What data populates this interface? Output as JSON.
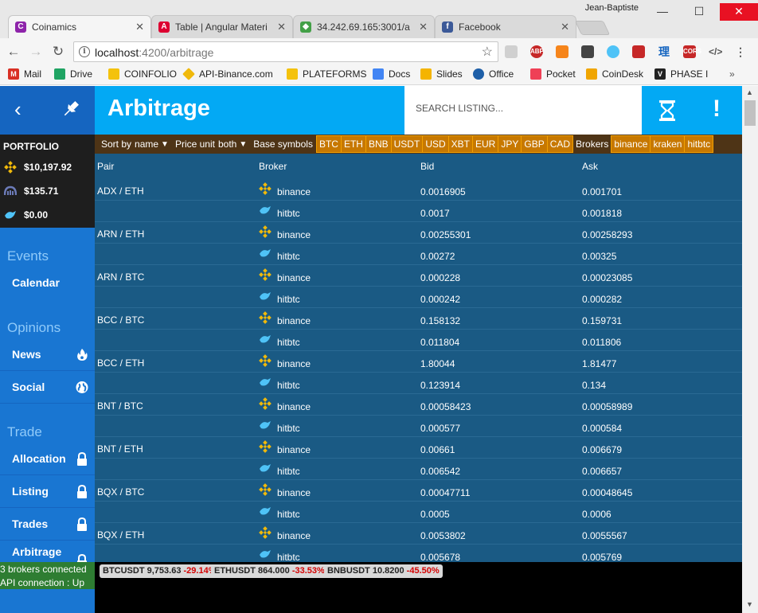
{
  "window": {
    "user": "Jean-Baptiste"
  },
  "tabs": [
    {
      "title": "Coinamics",
      "icon": "coinamics-favicon",
      "active": true
    },
    {
      "title": "Table | Angular Materi",
      "icon": "angular-favicon"
    },
    {
      "title": "34.242.69.165:3001/a",
      "icon": "node-favicon"
    },
    {
      "title": "Facebook",
      "icon": "facebook-favicon"
    }
  ],
  "address": {
    "host": "localhost",
    "path": ":4200/arbitrage"
  },
  "bookmarks": [
    {
      "label": "Mail",
      "icon": "gmail-icon",
      "color": "#d93025"
    },
    {
      "label": "Drive",
      "icon": "drive-icon",
      "color": "#1fa463"
    },
    {
      "label": "COINFOLIO",
      "icon": "folder-icon",
      "color": "#f4c20d"
    },
    {
      "label": "API-Binance.com",
      "icon": "binance-icon",
      "color": "#f0b90b"
    },
    {
      "label": "PLATEFORMS",
      "icon": "folder-icon",
      "color": "#f4c20d"
    },
    {
      "label": "Docs",
      "icon": "docs-icon",
      "color": "#4285f4"
    },
    {
      "label": "Slides",
      "icon": "slides-icon",
      "color": "#f4b400"
    },
    {
      "label": "Office",
      "icon": "office-icon",
      "color": "#1e5fa8"
    },
    {
      "label": "Pocket",
      "icon": "pocket-icon",
      "color": "#ef4056"
    },
    {
      "label": "CoinDesk",
      "icon": "coindesk-icon",
      "color": "#f0a500"
    },
    {
      "label": "PHASE I",
      "icon": "phase-icon",
      "color": "#222222"
    }
  ],
  "header": {
    "title": "Arbitrage",
    "search_placeholder": "SEARCH LISTING..."
  },
  "portfolio": {
    "title": "PORTFOLIO",
    "rows": [
      {
        "value": "$10,197.92",
        "icon": "binance-icon"
      },
      {
        "value": "$135.71",
        "icon": "kraken-icon"
      },
      {
        "value": "$0.00",
        "icon": "hitbtc-icon"
      }
    ]
  },
  "sidebar": {
    "events": {
      "title": "Events",
      "items": [
        "Calendar"
      ]
    },
    "opinions": {
      "title": "Opinions",
      "items": [
        "News",
        "Social"
      ]
    },
    "trade": {
      "title": "Trade",
      "items": [
        "Allocation",
        "Listing",
        "Trades",
        "Arbitrage"
      ]
    }
  },
  "status": {
    "brokers": "3 brokers connected",
    "api": "API connection : Up"
  },
  "filters": {
    "sort_label": "Sort by",
    "sort_value": "name",
    "price_label": "Price unit",
    "price_value": "both",
    "base_label": "Base symbols",
    "base_symbols": [
      "BTC",
      "ETH",
      "BNB",
      "USDT",
      "USD",
      "XBT",
      "EUR",
      "JPY",
      "GBP",
      "CAD"
    ],
    "brokers_label": "Brokers",
    "brokers": [
      "binance",
      "kraken",
      "hitbtc"
    ]
  },
  "table": {
    "columns": [
      "Pair",
      "Broker",
      "Bid",
      "Ask"
    ],
    "rows": [
      {
        "pair": "ADX / ETH",
        "broker": "binance",
        "bid": "0.0016905",
        "ask": "0.001701"
      },
      {
        "pair": "",
        "broker": "hitbtc",
        "bid": "0.0017",
        "ask": "0.001818"
      },
      {
        "pair": "ARN / ETH",
        "broker": "binance",
        "bid": "0.00255301",
        "ask": "0.00258293"
      },
      {
        "pair": "",
        "broker": "hitbtc",
        "bid": "0.00272",
        "ask": "0.00325"
      },
      {
        "pair": "ARN / BTC",
        "broker": "binance",
        "bid": "0.000228",
        "ask": "0.00023085"
      },
      {
        "pair": "",
        "broker": "hitbtc",
        "bid": "0.000242",
        "ask": "0.000282"
      },
      {
        "pair": "BCC / BTC",
        "broker": "binance",
        "bid": "0.158132",
        "ask": "0.159731"
      },
      {
        "pair": "",
        "broker": "hitbtc",
        "bid": "0.011804",
        "ask": "0.011806"
      },
      {
        "pair": "BCC / ETH",
        "broker": "binance",
        "bid": "1.80044",
        "ask": "1.81477"
      },
      {
        "pair": "",
        "broker": "hitbtc",
        "bid": "0.123914",
        "ask": "0.134"
      },
      {
        "pair": "BNT / BTC",
        "broker": "binance",
        "bid": "0.00058423",
        "ask": "0.00058989"
      },
      {
        "pair": "",
        "broker": "hitbtc",
        "bid": "0.000577",
        "ask": "0.000584"
      },
      {
        "pair": "BNT / ETH",
        "broker": "binance",
        "bid": "0.00661",
        "ask": "0.006679"
      },
      {
        "pair": "",
        "broker": "hitbtc",
        "bid": "0.006542",
        "ask": "0.006657"
      },
      {
        "pair": "BQX / BTC",
        "broker": "binance",
        "bid": "0.00047711",
        "ask": "0.00048645"
      },
      {
        "pair": "",
        "broker": "hitbtc",
        "bid": "0.0005",
        "ask": "0.0006"
      },
      {
        "pair": "BQX / ETH",
        "broker": "binance",
        "bid": "0.0053802",
        "ask": "0.0055567"
      },
      {
        "pair": "",
        "broker": "hitbtc",
        "bid": "0.005678",
        "ask": "0.005769"
      }
    ]
  },
  "tickers": [
    {
      "symbol": "BTCUSDT",
      "price": "9,753.63",
      "change": "-29.14%"
    },
    {
      "symbol": "ETHUSDT",
      "price": "864.000",
      "change": "-33.53%"
    },
    {
      "symbol": "BNBUSDT",
      "price": "10.8200",
      "change": "-45.50%"
    }
  ]
}
